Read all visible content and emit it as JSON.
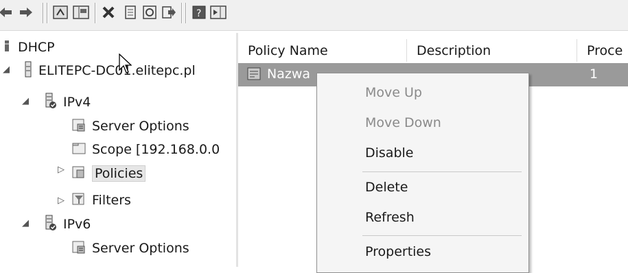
{
  "toolbar": {
    "buttons": [
      "back-icon",
      "forward-icon",
      "up-icon",
      "show-hide-tree-icon",
      "delete-icon",
      "properties-icon",
      "refresh-icon",
      "export-list-icon",
      "help-icon",
      "action-pane-icon"
    ]
  },
  "tree": {
    "root": "DHCP",
    "server": "ELITEPC-DC01.elitepc.pl",
    "ipv4": "IPv4",
    "server_options": "Server Options",
    "scope": "Scope [192.168.0.0",
    "policies": "Policies",
    "filters": "Filters",
    "ipv6": "IPv6",
    "server_options_v6": "Server Options"
  },
  "list": {
    "columns": [
      "Policy Name",
      "Description",
      "Proce"
    ],
    "row": {
      "name": "Nazwa",
      "order": "1"
    }
  },
  "context_menu": {
    "items": [
      "Move Up",
      "Move Down",
      "Disable",
      "Delete",
      "Refresh",
      "Properties"
    ]
  },
  "colors": {
    "selection": "#9a9a9a",
    "menu_bg": "#f5f5f5"
  }
}
